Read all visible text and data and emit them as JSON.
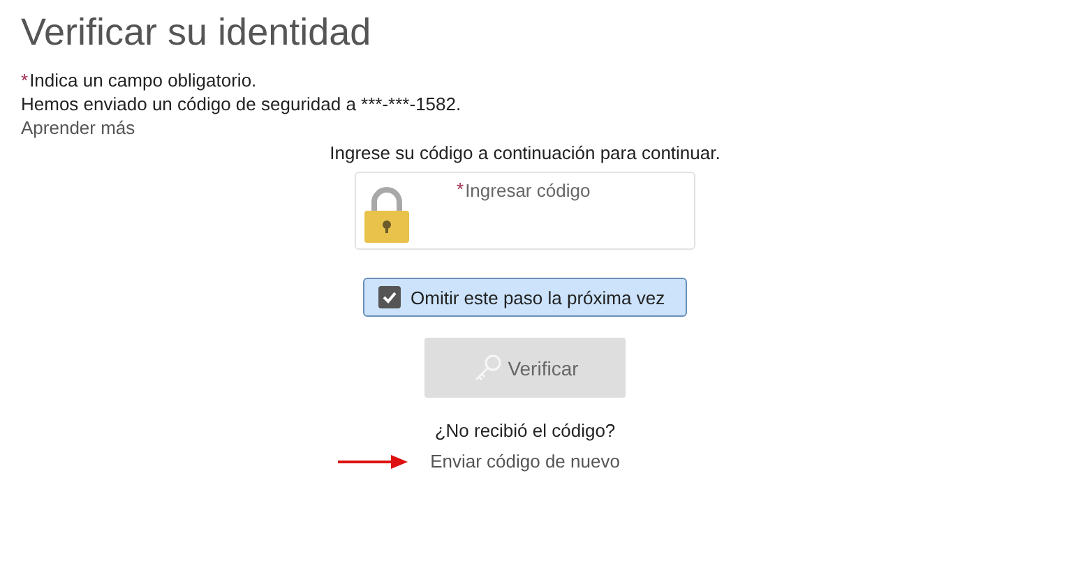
{
  "title": "Verificar su identidad",
  "required_note": {
    "mark": "*",
    "text": "Indica un campo obligatorio."
  },
  "sent_message": "Hemos enviado un código de seguridad a ***-***-1582.",
  "learn_more_link": "Aprender más",
  "instruction": "Ingrese su código a continuación para continuar.",
  "code_field": {
    "required_mark": "*",
    "placeholder": "Ingresar código"
  },
  "skip_checkbox": {
    "label": "Omitir este paso la próxima vez",
    "checked": true
  },
  "verify_button": {
    "label": "Verificar",
    "disabled": true
  },
  "no_code_question": "¿No recibió el código?",
  "resend_link": "Enviar código de nuevo"
}
